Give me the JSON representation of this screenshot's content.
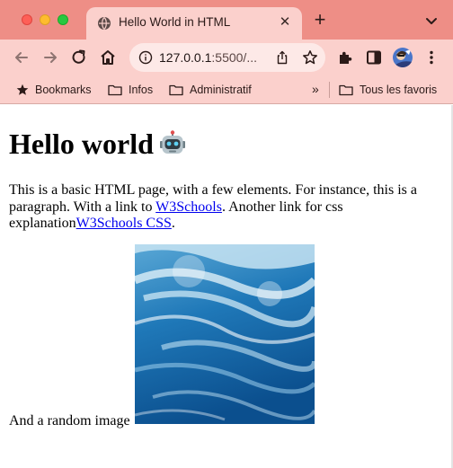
{
  "browser": {
    "tab": {
      "title": "Hello World in HTML"
    },
    "new_tab_symbol": "+",
    "close_symbol": "✕",
    "omnibox": {
      "host": "127.0.0.1",
      "rest": ":5500/..."
    },
    "bookmarks": [
      {
        "label": "Bookmarks",
        "icon": "star-icon"
      },
      {
        "label": "Infos",
        "icon": "folder-icon"
      },
      {
        "label": "Administratif",
        "icon": "folder-icon"
      }
    ],
    "overflow_chevron": "»",
    "all_bookmarks": {
      "label": "Tous les favoris",
      "icon": "folder-icon"
    },
    "theme": {
      "tabstrip": "#ee8e86",
      "toolbar": "#fbd0cc",
      "link": "#0000ee"
    }
  },
  "page": {
    "heading": "Hello world",
    "heading_emoji": "robot-face",
    "paragraph": {
      "text1": "This is a basic HTML page, with a few elements. For instance, this is a paragraph. With a link to ",
      "link1": "W3Schools",
      "text2": ". Another link for css explanation",
      "link2": "W3Schools CSS",
      "text3": "."
    },
    "image_caption": "And a random image",
    "image_subject": "ocean waves"
  }
}
